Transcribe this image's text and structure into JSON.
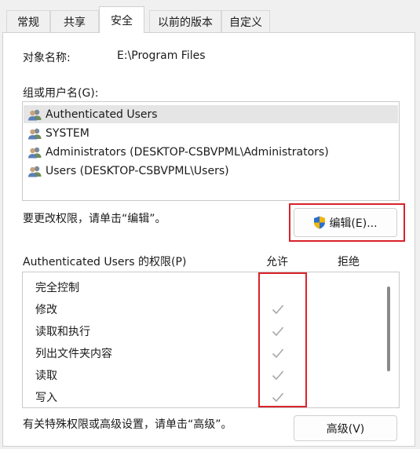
{
  "tabs": [
    {
      "label": "常规"
    },
    {
      "label": "共享"
    },
    {
      "label": "安全"
    },
    {
      "label": "以前的版本"
    },
    {
      "label": "自定义"
    }
  ],
  "object": {
    "label": "对象名称:",
    "value": "E:\\Program Files"
  },
  "groups": {
    "label": "组或用户名(G):",
    "items": [
      {
        "name": "Authenticated Users"
      },
      {
        "name": "SYSTEM"
      },
      {
        "name": "Administrators (DESKTOP-CSBVPML\\Administrators)"
      },
      {
        "name": "Users (DESKTOP-CSBVPML\\Users)"
      }
    ]
  },
  "change_hint": "要更改权限，请单击“编辑”。",
  "edit_button": "编辑(E)...",
  "permissions": {
    "title": "Authenticated Users 的权限(P)",
    "allow_header": "允许",
    "deny_header": "拒绝",
    "items": [
      {
        "name": "完全控制",
        "allow": false
      },
      {
        "name": "修改",
        "allow": true
      },
      {
        "name": "读取和执行",
        "allow": true
      },
      {
        "name": "列出文件夹内容",
        "allow": true
      },
      {
        "name": "读取",
        "allow": true
      },
      {
        "name": "写入",
        "allow": true
      }
    ]
  },
  "advanced_hint": "有关特殊权限或高级设置，请单击“高级”。",
  "advanced_button": "高级(V)",
  "colors": {
    "highlight": "#d9222a",
    "check": "#a8a8a8"
  }
}
